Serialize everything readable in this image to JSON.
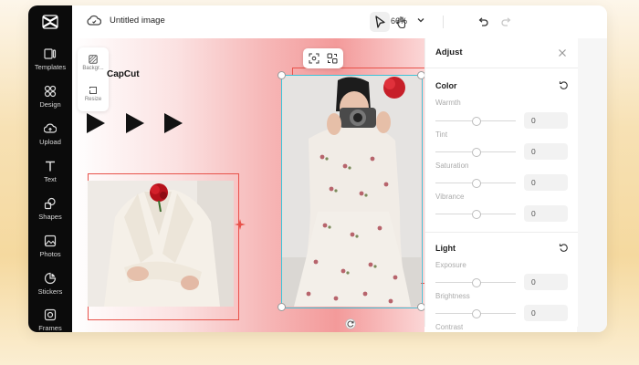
{
  "topbar": {
    "title": "Untitled image",
    "zoom": "66%"
  },
  "sidebar": {
    "items": [
      {
        "label": "Templates",
        "icon": "templates-icon"
      },
      {
        "label": "Design",
        "icon": "design-icon"
      },
      {
        "label": "Upload",
        "icon": "upload-icon"
      },
      {
        "label": "Text",
        "icon": "text-icon"
      },
      {
        "label": "Shapes",
        "icon": "shapes-icon"
      },
      {
        "label": "Photos",
        "icon": "photos-icon"
      },
      {
        "label": "Stickers",
        "icon": "stickers-icon"
      },
      {
        "label": "Frames",
        "icon": "frames-icon"
      }
    ]
  },
  "canvas": {
    "brand": "CapCut",
    "floating_panel": {
      "background_label": "Backgr...",
      "resize_label": "Resize"
    }
  },
  "panel": {
    "title": "Adjust",
    "color_section": "Color",
    "light_section": "Light",
    "color_sliders": [
      {
        "label": "Warmth",
        "value": "0"
      },
      {
        "label": "Tint",
        "value": "0"
      },
      {
        "label": "Saturation",
        "value": "0"
      },
      {
        "label": "Vibrance",
        "value": "0"
      }
    ],
    "light_sliders": [
      {
        "label": "Exposure",
        "value": "0"
      },
      {
        "label": "Brightness",
        "value": "0"
      },
      {
        "label": "Contrast",
        "value": ""
      }
    ]
  },
  "colors": {
    "accent_selection": "#3cc4d8",
    "frame_red": "#e8524a",
    "sidebar_bg": "#0b0b0b"
  }
}
